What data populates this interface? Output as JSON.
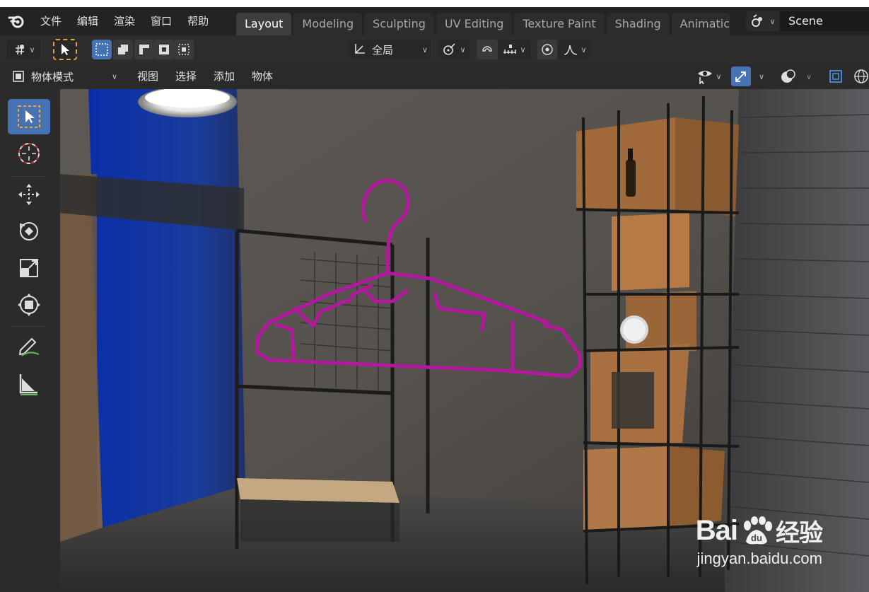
{
  "menubar": {
    "items": [
      "文件",
      "编辑",
      "渲染",
      "窗口",
      "帮助"
    ],
    "workspaces": [
      "Layout",
      "Modeling",
      "Sculpting",
      "UV Editing",
      "Texture Paint",
      "Shading",
      "Animatic"
    ],
    "active_workspace": "Layout",
    "scene": "Scene"
  },
  "toolheader": {
    "transform_orientation": "全局"
  },
  "viewport_header": {
    "mode": "物体模式",
    "menus": [
      "视图",
      "选择",
      "添加",
      "物体"
    ]
  },
  "toolbar": {
    "tools": [
      "select-box-icon",
      "cursor-icon",
      "move-icon",
      "rotate-icon",
      "scale-icon",
      "transform-icon",
      "annotate-icon",
      "measure-icon"
    ]
  },
  "watermark": {
    "brand": "Bai",
    "brand2": "经验",
    "url": "jingyan.baidu.com"
  },
  "colors": {
    "accent": "#4772b3",
    "hanger": "#b4189e",
    "header": "#2d2d2d"
  }
}
